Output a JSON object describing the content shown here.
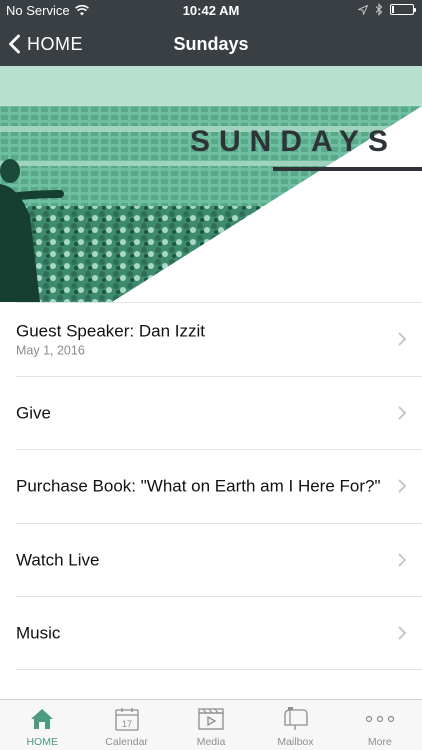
{
  "status_bar": {
    "carrier": "No Service",
    "time": "10:42 AM",
    "battery_level": 0.1
  },
  "nav": {
    "back_label": "HOME",
    "title": "Sundays"
  },
  "hero": {
    "banner_text": "SUNDAYS",
    "accent_color": "#4a9b7f"
  },
  "list": {
    "items": [
      {
        "title": "Guest Speaker: Dan Izzit",
        "subtitle": "May 1, 2016"
      },
      {
        "title": "Give",
        "subtitle": ""
      },
      {
        "title": "Purchase Book: \"What on Earth am I Here For?\"",
        "subtitle": ""
      },
      {
        "title": "Watch Live",
        "subtitle": ""
      },
      {
        "title": "Music",
        "subtitle": ""
      }
    ]
  },
  "tabbar": {
    "tabs": [
      {
        "label": "HOME",
        "icon": "home-icon",
        "active": true
      },
      {
        "label": "Calendar",
        "icon": "calendar-icon",
        "calendar_day": "17"
      },
      {
        "label": "Media",
        "icon": "media-icon"
      },
      {
        "label": "Mailbox",
        "icon": "mailbox-icon"
      },
      {
        "label": "More",
        "icon": "more-icon"
      }
    ]
  }
}
